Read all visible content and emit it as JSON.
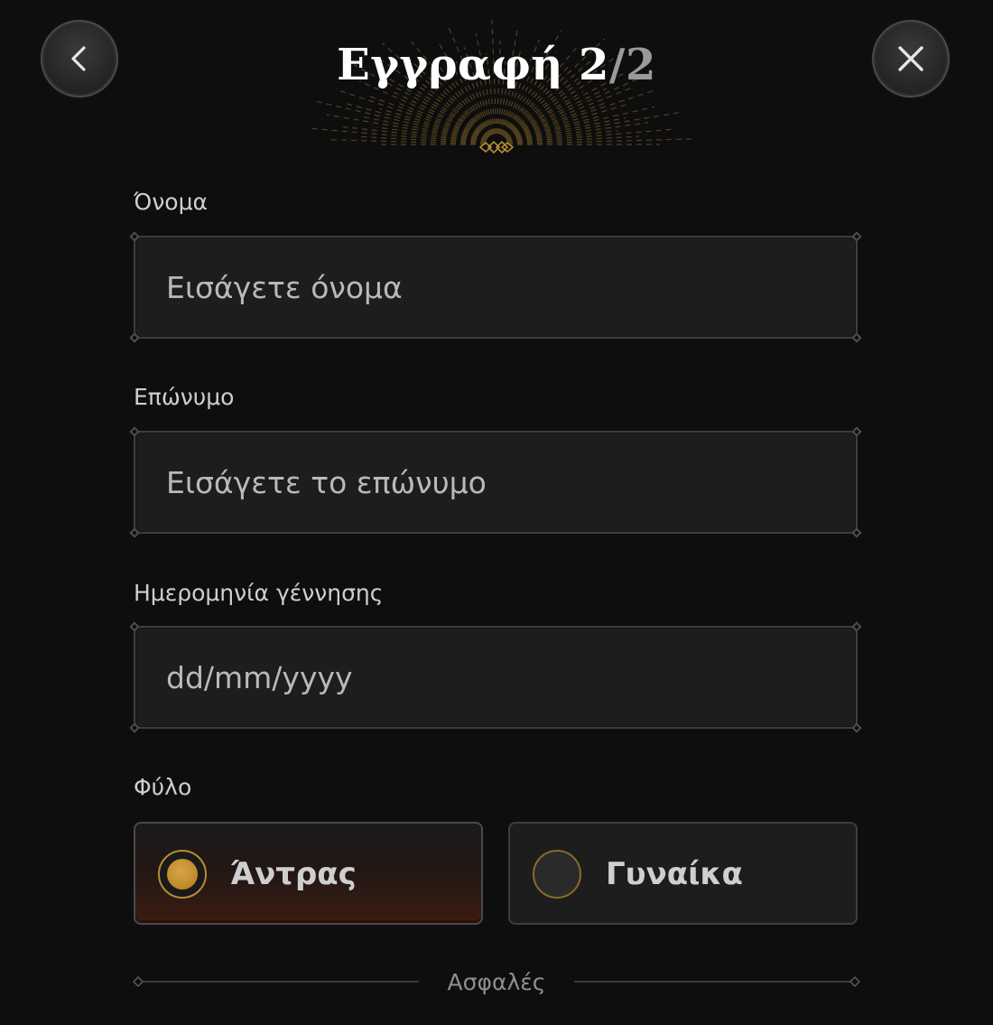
{
  "header": {
    "title_prefix": "Εγγραφή 2",
    "title_total": "/2",
    "back_icon": "chevron-left-icon",
    "close_icon": "close-icon",
    "accent_color": "#b58d36"
  },
  "form": {
    "first_name": {
      "label": "Όνομα",
      "placeholder": "Εισάγετε όνομα",
      "value": ""
    },
    "last_name": {
      "label": "Επώνυμο",
      "placeholder": "Εισάγετε το επώνυμο",
      "value": ""
    },
    "birth_date": {
      "label": "Ημερομηνία γέννησης",
      "placeholder": "dd/mm/yyyy",
      "value": ""
    },
    "gender": {
      "label": "Φύλο",
      "options": [
        {
          "label": "Άντρας",
          "selected": true
        },
        {
          "label": "Γυναίκα",
          "selected": false
        }
      ]
    }
  },
  "footer": {
    "secure_label": "Ασφαλές"
  }
}
